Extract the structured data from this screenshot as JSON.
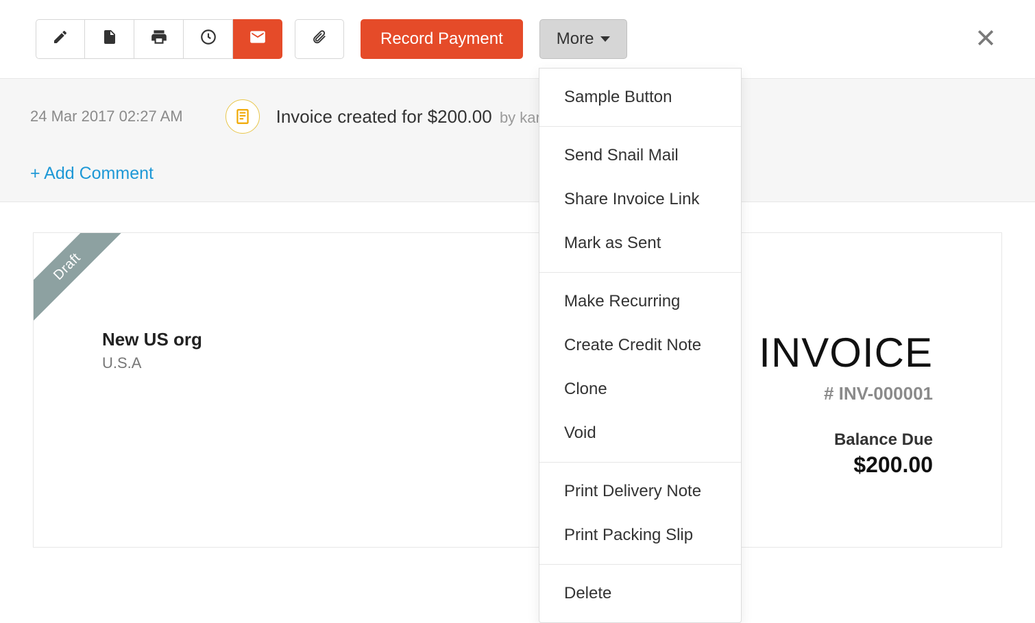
{
  "toolbar": {
    "record_label": "Record Payment",
    "more_label": "More"
  },
  "activity": {
    "date": "24 Mar 2017 02:27 AM",
    "text_prefix": "Invoice created for ",
    "amount": "$200.00",
    "by_prefix": "by ",
    "by_user": "karthi",
    "add_comment": "+ Add Comment"
  },
  "invoice": {
    "ribbon": "Draft",
    "org_name": "New US org",
    "org_country": "U.S.A",
    "title": "INVOICE",
    "number": "# INV-000001",
    "balance_label": "Balance Due",
    "balance_value": "$200.00"
  },
  "dropdown": {
    "g1": [
      "Sample Button"
    ],
    "g2": [
      "Send Snail Mail",
      "Share Invoice Link",
      "Mark as Sent"
    ],
    "g3": [
      "Make Recurring",
      "Create Credit Note",
      "Clone",
      "Void"
    ],
    "g4": [
      "Print Delivery Note",
      "Print Packing Slip"
    ],
    "g5": [
      "Delete"
    ]
  }
}
